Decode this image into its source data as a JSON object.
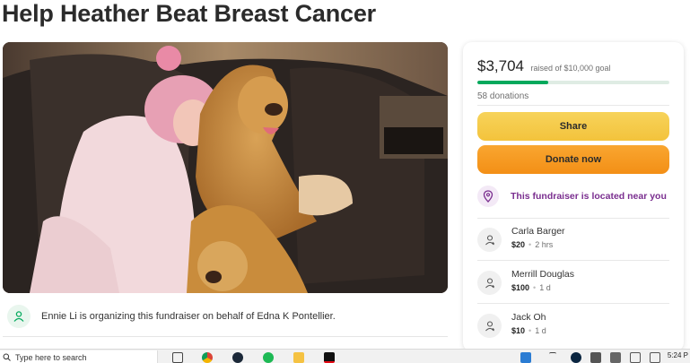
{
  "page": {
    "title": "Help Heather Beat Breast Cancer"
  },
  "organizer": {
    "text": "Ennie Li is organizing this fundraiser on behalf of Edna K Pontellier."
  },
  "sidebar": {
    "raised_amount": "$3,704",
    "raised_goal": "raised of $10,000 goal",
    "progress": 0.3704,
    "donations": "58 donations",
    "share_label": "Share",
    "donate_label": "Donate now",
    "near_text": "This fundraiser is located near you",
    "donors": [
      {
        "name": "Carla Barger",
        "amount": "$20",
        "time": "2 hrs"
      },
      {
        "name": "Merrill Douglas",
        "amount": "$100",
        "time": "1 d"
      },
      {
        "name": "Jack Oh",
        "amount": "$10",
        "time": "1 d"
      }
    ]
  },
  "taskbar": {
    "search_placeholder": "Type here to search",
    "time": "5:24 P",
    "icons": [
      "task-view-icon",
      "chrome-icon",
      "steam-icon",
      "spotify-icon",
      "file-explorer-icon",
      "netflix-icon"
    ]
  },
  "colors": {
    "brand_green": "#02a95c",
    "share_yellow": "#f3c33c",
    "donate_orange": "#f38f16",
    "near_purple": "#7a2e8f"
  }
}
